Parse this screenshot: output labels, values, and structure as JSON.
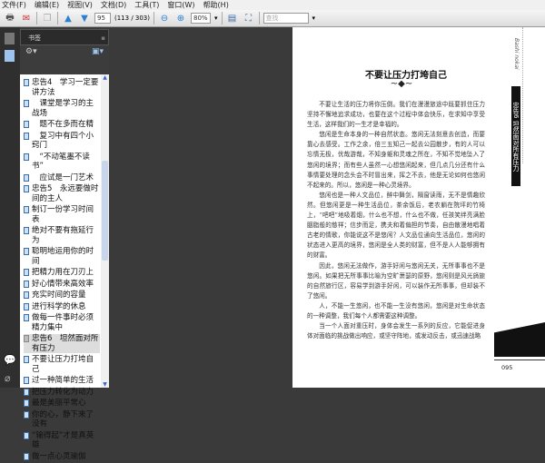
{
  "menu": [
    "文件(F)",
    "编辑(E)",
    "视图(V)",
    "文档(D)",
    "工具(T)",
    "窗口(W)",
    "帮助(H)"
  ],
  "toolbar": {
    "page_input": "95",
    "page_count": "(113 / 303)",
    "zoom": "80%",
    "search_placeholder": "查找"
  },
  "panel": {
    "title": "书签"
  },
  "bookmarks": [
    {
      "label": "忠告4　学习一定要讲方法",
      "selected": false
    },
    {
      "label": "　课堂是学习的主战场",
      "selected": false
    },
    {
      "label": "　题不在多而在精",
      "selected": false
    },
    {
      "label": "　复习中有四个小窍门",
      "selected": false
    },
    {
      "label": "　“不动笔墨不读书”",
      "selected": false
    },
    {
      "label": "　应试是一门艺术",
      "selected": false
    },
    {
      "label": "忠告5　永远要做时间的主人",
      "selected": false
    },
    {
      "label": "制订一份学习时间表",
      "selected": false
    },
    {
      "label": "绝对不要有拖延行为",
      "selected": false
    },
    {
      "label": "聪明地运用你的时间",
      "selected": false
    },
    {
      "label": "把精力用在刀刃上",
      "selected": false
    },
    {
      "label": "好心情带来高效率",
      "selected": false
    },
    {
      "label": "充实时间的容量",
      "selected": false
    },
    {
      "label": "进行科学的休息",
      "selected": false
    },
    {
      "label": "做每一件事时必须精力集中",
      "selected": false
    },
    {
      "label": "忠告6　坦然面对所有压力",
      "selected": true
    },
    {
      "label": "不要让压力打垮自己",
      "selected": false
    },
    {
      "label": "过一种简单的生活",
      "selected": false
    },
    {
      "label": "把压力转化为动力",
      "selected": false
    },
    {
      "label": "最是美丽平常心",
      "selected": false
    },
    {
      "label": "你的心，静下来了没有",
      "selected": false
    },
    {
      "label": "“输得起”才是真英雄",
      "selected": false
    },
    {
      "label": "做一点心灵瑜伽",
      "selected": false
    }
  ],
  "document": {
    "title": "不要让压力打垮自己",
    "running_head": "Bashi nokai",
    "side_tab": "忠告6 坦然面对所有压力",
    "paragraphs": [
      "不要让生活的压力将你压倒。我们在漫漫旅途中既要抓住压力坚持不懈地追求成功，也要在这个过程中体会快乐，在求知中享受生活，这样我们的一生才是幸福的。",
      "悠闲是生命本身的一种自然状态。悠闲无法刻意去创造，而要靠心去感受。工作之余，倍三五知己一起去公园散步，有的人可以忘情无极，优哉游哉，不知身躯和灵魂之所在，不知不觉地坠入了悠闲的境界；而有些人虽然一心想悠闲起来，但几点几分还有什么事情要处理的念头会不时冒出来，挥之不去，他是无论如何也悠闲不起来的。所以，悠闲是一种心灵境界。",
      "悠闲也是一种人文品位，醉中舞剑，隔窗读雨，无不是情趣欣然。但悠闲更是一种生活品位，茶余饭后，老农躺在院坪的竹椅上，“吧吧”地吸着烟，什么也不想，什么也不做，任孩笑绊亮满脸胭脂般的慈祥；信步而足，携夫和着偏担的节奏，自由散漫地唱着古老的情歌，你能说这不是悠闲？人文品位通向生活品位，悠闲的状态进入更高的境界，悠闲是全人类的财富，但不是人人能够拥有的财富。",
      "因此，悠闲无法做作，游手好闲与悠闲无关，无所事事也不是悠闲。如果把无所事事比喻为空旷萧瑟的原野，悠闲则是风光旖旎的自然旅行区，容易学到游手好闲，可以装作无所事事，但却装不了悠闲。",
      "人，不能一生悠闲，也不能一生没有悠闲，悠闲是对生命状态的一种调整，我们每个人都需要这种调整。",
      "当一个人面对重压时，身体会发生一系列的反应，它能促进身体对面临的挑战做出响应，或坚守阵地，或发动反击，或迅速战略"
    ],
    "page_number": "095"
  }
}
